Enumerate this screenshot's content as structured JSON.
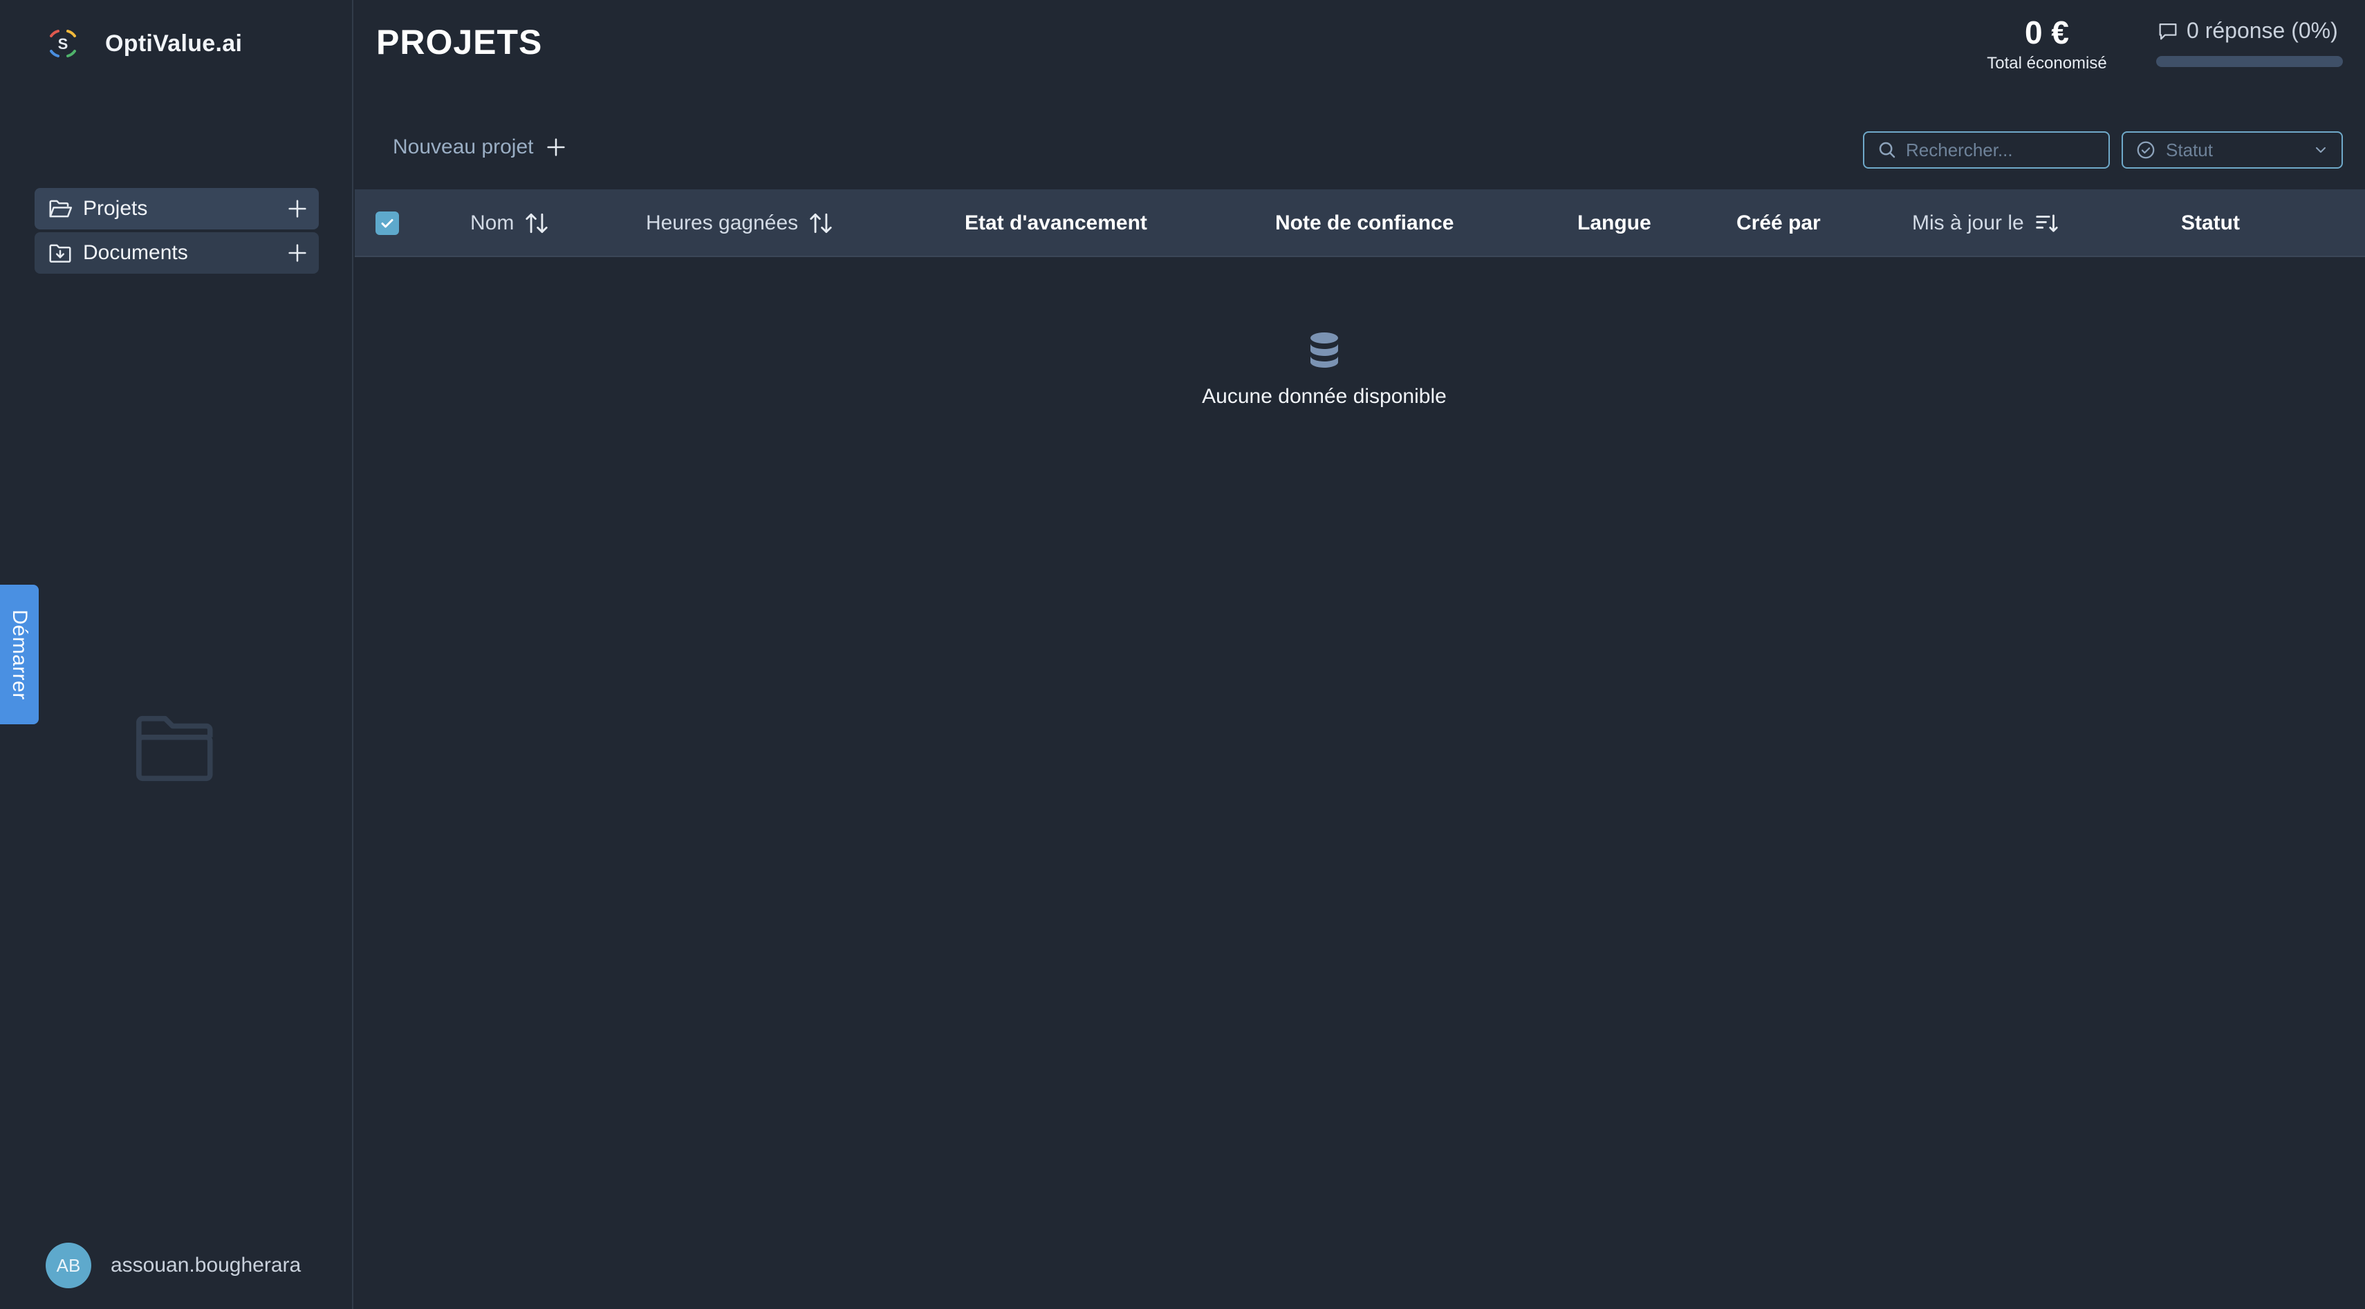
{
  "app": {
    "name": "OptiValue.ai",
    "logo_letter": "S"
  },
  "sidebar": {
    "items": [
      {
        "label": "Projets",
        "icon": "folder-open-icon",
        "active": true
      },
      {
        "label": "Documents",
        "icon": "folder-download-icon",
        "active": false
      }
    ],
    "start_tab": "Démarrer",
    "user": {
      "initials": "AB",
      "name": "assouan.bougherara"
    }
  },
  "header": {
    "title": "PROJETS",
    "savings_value": "0 €",
    "savings_label": "Total économisé",
    "responses_text": "0 réponse (0%)",
    "responses_progress": 0
  },
  "toolbar": {
    "new_project_label": "Nouveau projet",
    "search_placeholder": "Rechercher...",
    "status_placeholder": "Statut"
  },
  "table": {
    "columns": [
      {
        "label": "Nom",
        "sort": "sortable"
      },
      {
        "label": "Heures gagnées",
        "sort": "sortable"
      },
      {
        "label": "Etat d'avancement",
        "sort": "none"
      },
      {
        "label": "Note de confiance",
        "sort": "none"
      },
      {
        "label": "Langue",
        "sort": "none"
      },
      {
        "label": "Créé par",
        "sort": "none"
      },
      {
        "label": "Mis à jour le",
        "sort": "sorted-desc"
      },
      {
        "label": "Statut",
        "sort": "none"
      }
    ],
    "rows": [],
    "empty_text": "Aucune donnée disponible"
  },
  "colors": {
    "background": "#212833",
    "accent": "#5ea9cc",
    "start_tab": "#4a90e2"
  }
}
